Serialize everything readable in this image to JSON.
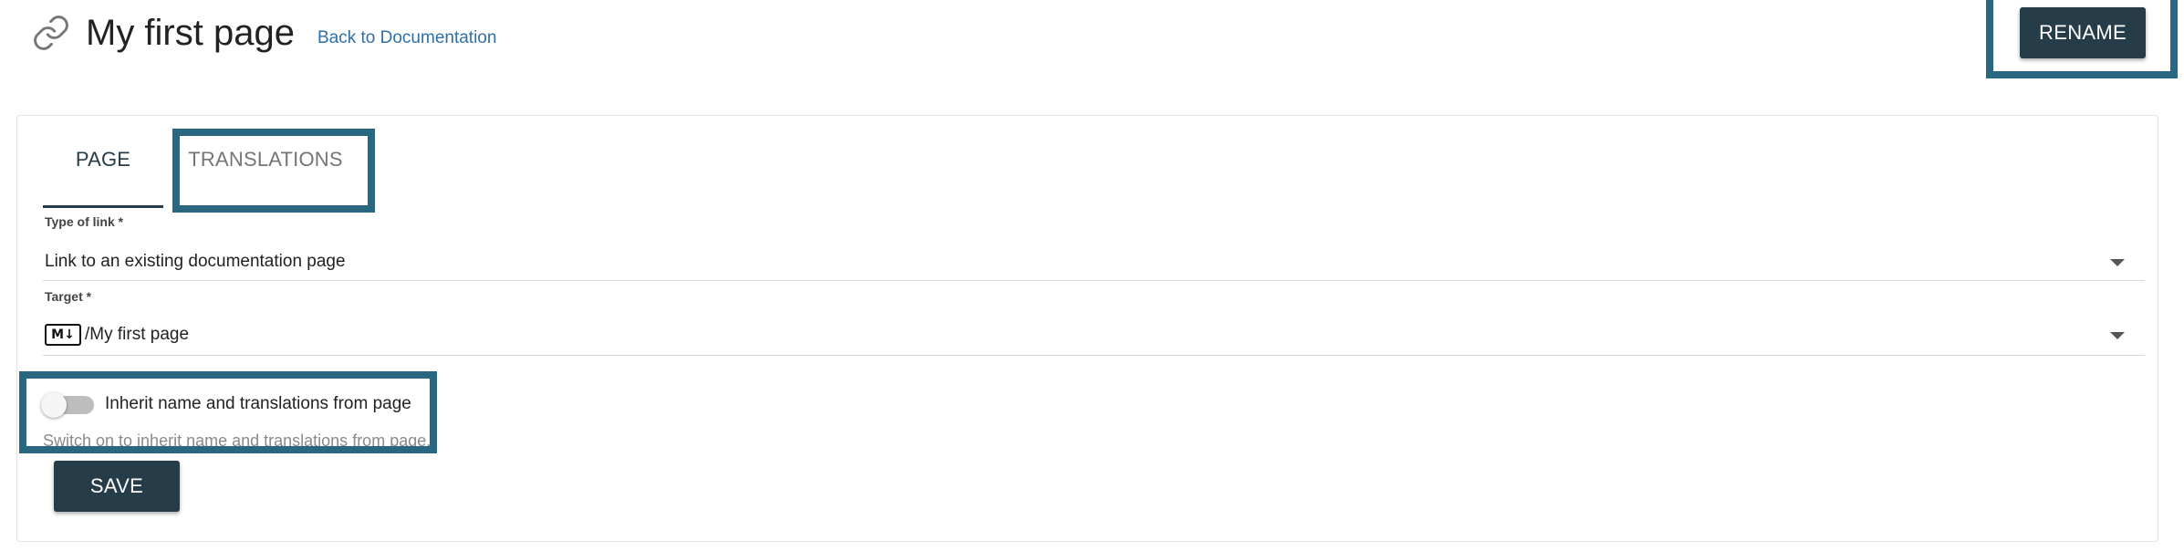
{
  "header": {
    "icon": "link-icon",
    "title": "My first page",
    "back_link": "Back to Documentation",
    "rename_label": "RENAME"
  },
  "tabs": [
    {
      "label": "PAGE",
      "active": true
    },
    {
      "label": "TRANSLATIONS",
      "active": false
    }
  ],
  "form": {
    "type_of_link": {
      "label": "Type of link *",
      "value": "Link to an existing documentation page"
    },
    "target": {
      "label": "Target *",
      "badge_icon": "markdown-icon",
      "badge_text": "M↓",
      "value": "/My first page"
    },
    "inherit_toggle": {
      "label": "Inherit name and translations from page",
      "hint": "Switch on to inherit name and translations from page.",
      "checked": false
    },
    "save_label": "SAVE"
  },
  "colors": {
    "primary_button": "#263c48",
    "highlight_border": "#29667f",
    "link": "#2f6fa8"
  }
}
